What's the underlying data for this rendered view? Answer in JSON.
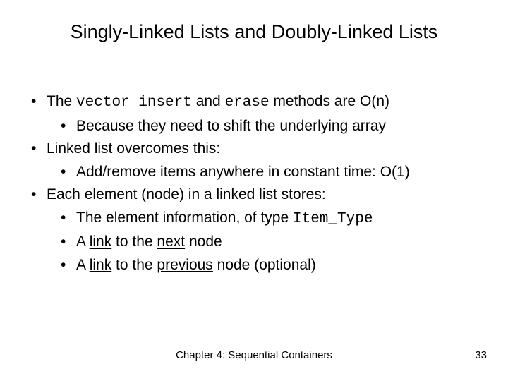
{
  "title": "Singly-Linked Lists and Doubly-Linked Lists",
  "bullets": {
    "b1_pre": "The ",
    "b1_code1": "vector insert",
    "b1_mid": " and ",
    "b1_code2": "erase",
    "b1_post": " methods are O(n)",
    "b1_1": "Because they need to shift the underlying array",
    "b2": "Linked list overcomes this:",
    "b2_1": "Add/remove items anywhere in constant time: O(1)",
    "b3": "Each element (node) in a linked list stores:",
    "b3_1_pre": "The element information, of type ",
    "b3_1_code": "Item_Type",
    "b3_2_pre": "A ",
    "b3_2_u1": "link",
    "b3_2_mid": " to the ",
    "b3_2_u2": "next",
    "b3_2_post": " node",
    "b3_3_pre": "A ",
    "b3_3_u1": "link",
    "b3_3_mid": " to the ",
    "b3_3_u2": "previous",
    "b3_3_post": " node (optional)"
  },
  "footer": {
    "chapter": "Chapter 4: Sequential Containers",
    "page": "33"
  }
}
